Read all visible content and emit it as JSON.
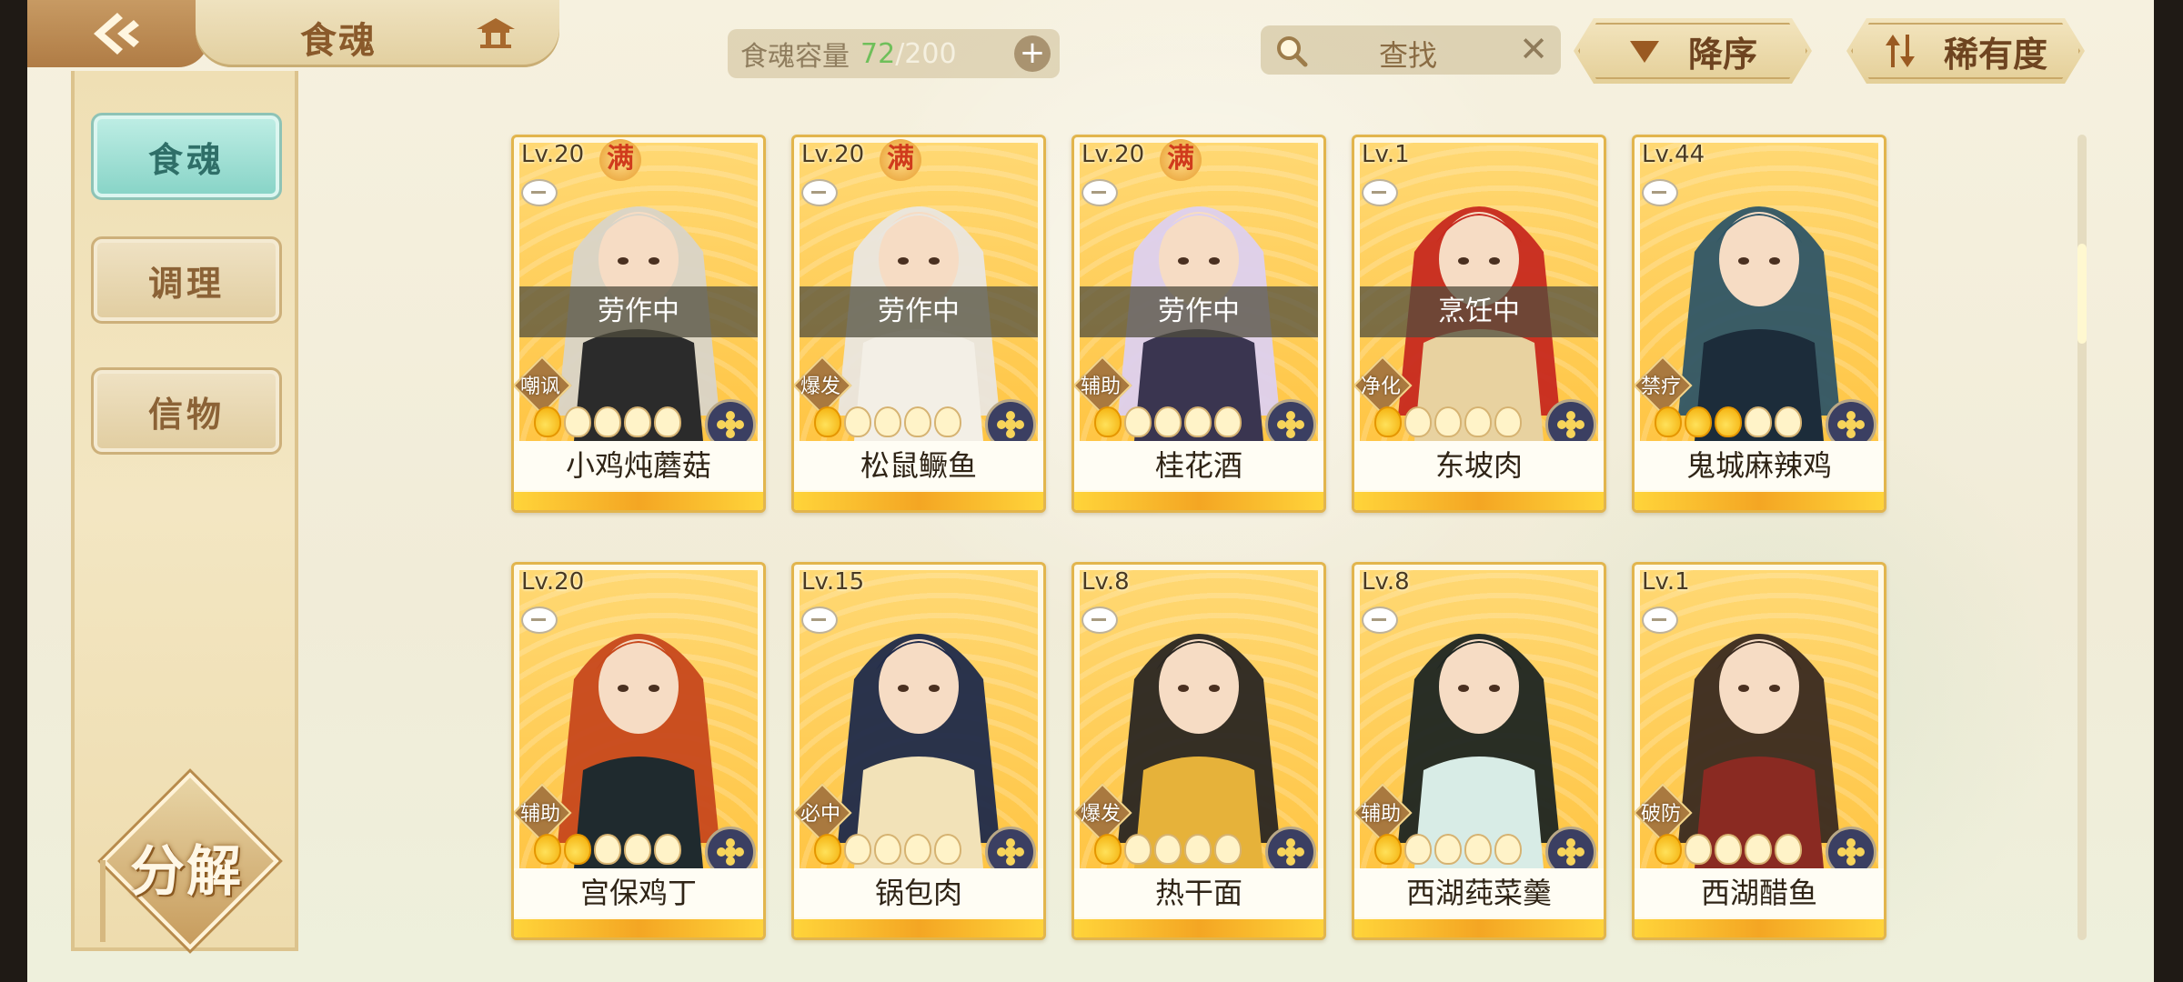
{
  "header": {
    "title": "食魂",
    "capacity_label": "食魂容量",
    "capacity_current": "72",
    "capacity_sep": "/",
    "capacity_max": "200",
    "capacity_add": "+",
    "search_placeholder": "查找",
    "search_clear": "✕",
    "sort_order_label": "降序",
    "sort_key_label": "稀有度"
  },
  "sidebar": {
    "items": [
      {
        "label": "食魂",
        "active": true
      },
      {
        "label": "调理",
        "active": false
      },
      {
        "label": "信物",
        "active": false
      }
    ],
    "decompose_label": "分解"
  },
  "cards": [
    {
      "level": "Lv.20",
      "full": "满",
      "status": "劳作中",
      "skill": "嘲讽",
      "name": "小鸡炖蘑菇",
      "stars": 1,
      "hair": "#d9d4c8",
      "cloth": "#2b2b2b"
    },
    {
      "level": "Lv.20",
      "full": "满",
      "status": "劳作中",
      "skill": "爆发",
      "name": "松鼠鳜鱼",
      "stars": 1,
      "hair": "#eae6df",
      "cloth": "#f3efe6"
    },
    {
      "level": "Lv.20",
      "full": "满",
      "status": "劳作中",
      "skill": "辅助",
      "name": "桂花酒",
      "stars": 1,
      "hair": "#ddd0ef",
      "cloth": "#3a3550"
    },
    {
      "level": "Lv.1",
      "full": "",
      "status": "烹饪中",
      "skill": "净化",
      "name": "东坡肉",
      "stars": 1,
      "hair": "#c7291f",
      "cloth": "#e8d2a0"
    },
    {
      "level": "Lv.44",
      "full": "",
      "status": "",
      "skill": "禁疗",
      "name": "鬼城麻辣鸡",
      "stars": 3,
      "hair": "#2f5566",
      "cloth": "#1c2c3a"
    },
    {
      "level": "Lv.20",
      "full": "",
      "status": "",
      "skill": "辅助",
      "name": "宫保鸡丁",
      "stars": 2,
      "hair": "#c7481c",
      "cloth": "#1f2a2e"
    },
    {
      "level": "Lv.15",
      "full": "",
      "status": "",
      "skill": "必中",
      "name": "锅包肉",
      "stars": 1,
      "hair": "#1f2a4a",
      "cloth": "#f2e2b8"
    },
    {
      "level": "Lv.8",
      "full": "",
      "status": "",
      "skill": "爆发",
      "name": "热干面",
      "stars": 1,
      "hair": "#2a2622",
      "cloth": "#e6b23a"
    },
    {
      "level": "Lv.8",
      "full": "",
      "status": "",
      "skill": "辅助",
      "name": "西湖莼菜羹",
      "stars": 1,
      "hair": "#1e2522",
      "cloth": "#d8ece6"
    },
    {
      "level": "Lv.1",
      "full": "",
      "status": "",
      "skill": "破防",
      "name": "西湖醋鱼",
      "stars": 1,
      "hair": "#3a2a20",
      "cloth": "#8a2a22"
    }
  ],
  "colors": {
    "accent_teal": "#86d3c6",
    "card_gold": "#ffc544",
    "star_on": "#f2a900"
  }
}
